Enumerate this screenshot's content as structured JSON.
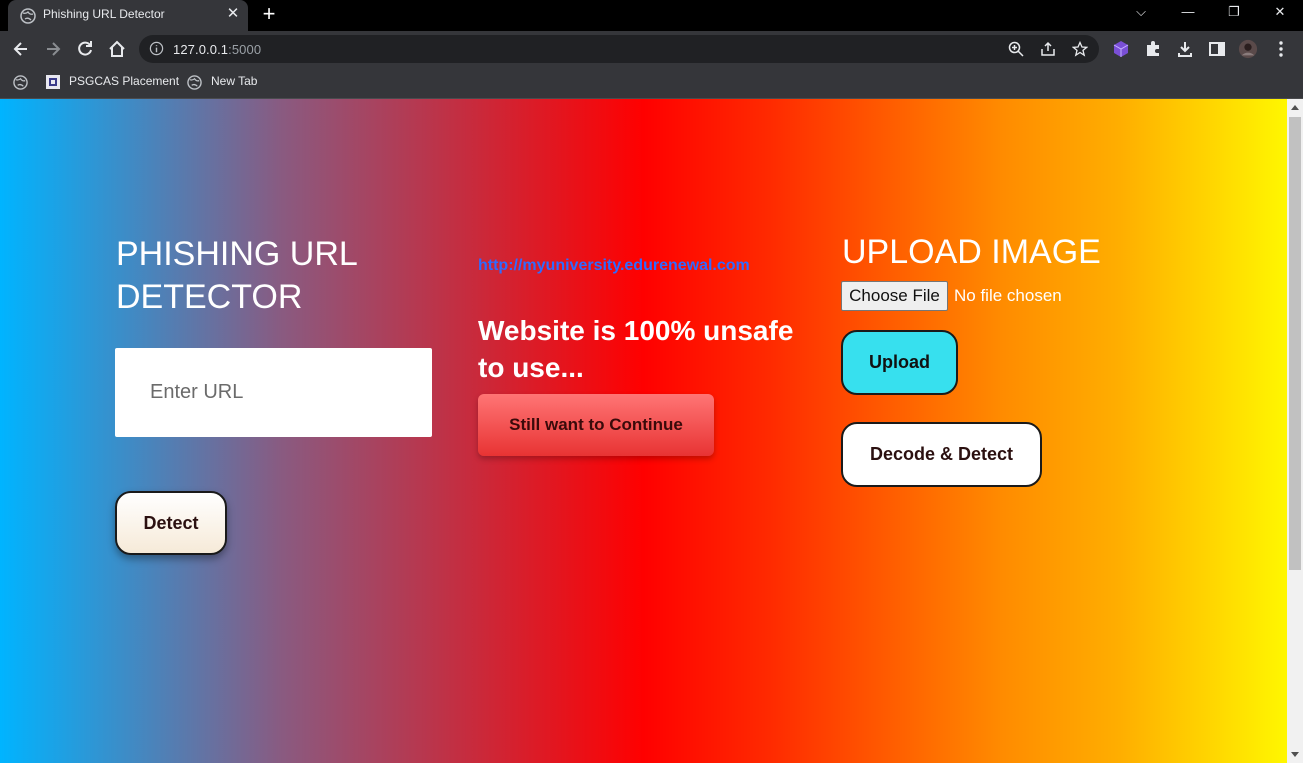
{
  "browser": {
    "tab_title": "Phishing URL Detector",
    "url_host": "127.0.0.1",
    "url_port": ":5000",
    "bookmarks": [
      {
        "label": "PSGCAS Placement"
      },
      {
        "label": "New Tab"
      }
    ]
  },
  "left": {
    "heading": "PHISHING URL DETECTOR",
    "url_placeholder": "Enter URL",
    "detect_label": "Detect"
  },
  "middle": {
    "checked_url": "http://myuniversity.edurenewal.com",
    "result_text": "Website is 100% unsafe to use...",
    "continue_label": "Still want to Continue"
  },
  "right": {
    "heading": "UPLOAD IMAGE",
    "choose_file_label": "Choose File",
    "no_file_text": "No file chosen",
    "upload_label": "Upload",
    "decode_label": "Decode & Detect"
  },
  "colors": {
    "gradient": [
      "#00b4ff",
      "#ff0000",
      "#ff8c00",
      "#fff700"
    ],
    "upload_button": "#37e0ee",
    "link": "#2f6bff"
  }
}
